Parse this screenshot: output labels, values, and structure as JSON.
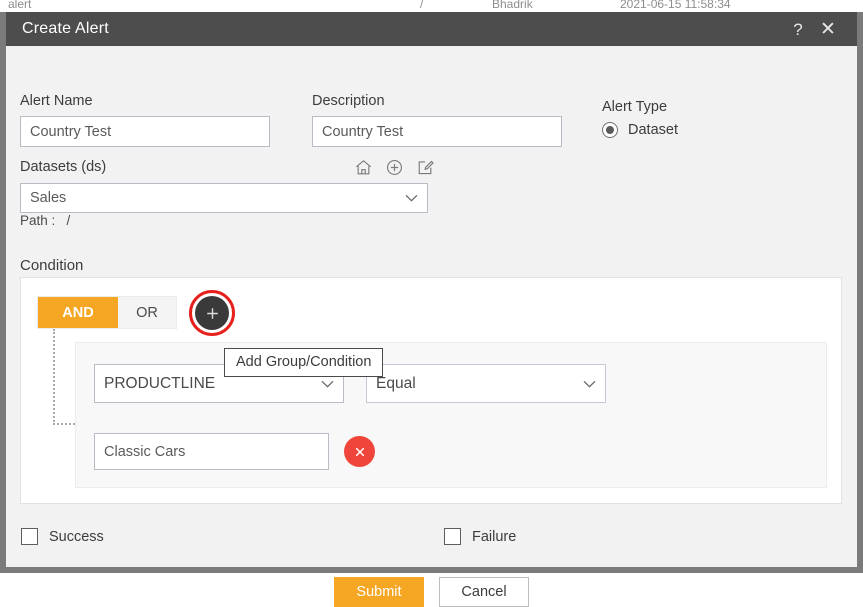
{
  "background_page": {
    "row_cells": [
      "alert",
      "/",
      "Bhadrik",
      "2021-06-15 11:58:34"
    ]
  },
  "dialog": {
    "title": "Create Alert",
    "help_icon": "question-mark-icon",
    "close_icon": "close-icon"
  },
  "form": {
    "alert_name": {
      "label": "Alert Name",
      "value": "Country Test",
      "placeholder": "Alert Name"
    },
    "description": {
      "label": "Description",
      "value": "Country Test",
      "placeholder": "Description"
    },
    "alert_type": {
      "label": "Alert Type",
      "selected": "Dataset",
      "options": [
        "Dataset"
      ]
    },
    "datasets": {
      "label": "Datasets (ds)",
      "value": "Sales",
      "icons": [
        "home-icon",
        "plus-circle-icon",
        "edit-icon"
      ],
      "path_label": "Path :",
      "path_value": "/"
    }
  },
  "condition": {
    "label": "Condition",
    "operator_toggle": {
      "and_label": "AND",
      "or_label": "OR",
      "selected": "AND"
    },
    "add_button": {
      "icon": "plus-icon",
      "tooltip": "Add Group/Condition",
      "highlight_color": "#e8201c"
    },
    "rows": [
      {
        "field": "PRODUCTLINE",
        "operator": "Equal",
        "value": "Classic Cars",
        "delete_icon": "close-icon"
      }
    ]
  },
  "notifications": {
    "success": {
      "label": "Success",
      "checked": false
    },
    "failure": {
      "label": "Failure",
      "checked": false
    }
  },
  "actions": {
    "submit": "Submit",
    "cancel": "Cancel"
  },
  "colors": {
    "accent_orange": "#f5a623",
    "titlebar": "#4d4d4d",
    "delete_red": "#f0453a",
    "highlight_red": "#e8201c"
  }
}
